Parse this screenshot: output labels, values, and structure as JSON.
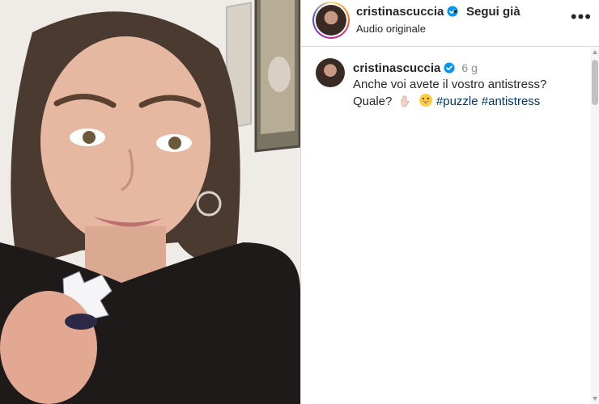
{
  "post": {
    "username": "cristinascuccia",
    "verified": true,
    "separator": "•",
    "follow_label": "Segui già",
    "audio_label": "Audio originale",
    "more_icon": "more-horizontal-icon"
  },
  "caption": {
    "username": "cristinascuccia",
    "time": "6 g",
    "text": "Anche voi avete il vostro antistress? Quale?",
    "emojis": [
      "pointing-down-hand",
      "grinning-face"
    ],
    "hashtags": [
      "#puzzle",
      "#antistress"
    ]
  },
  "colors": {
    "verified_blue": "#0095f6",
    "hashtag_blue": "#00376b",
    "text": "#262626",
    "muted": "#8e8e8e",
    "border": "#dbdbdb"
  }
}
